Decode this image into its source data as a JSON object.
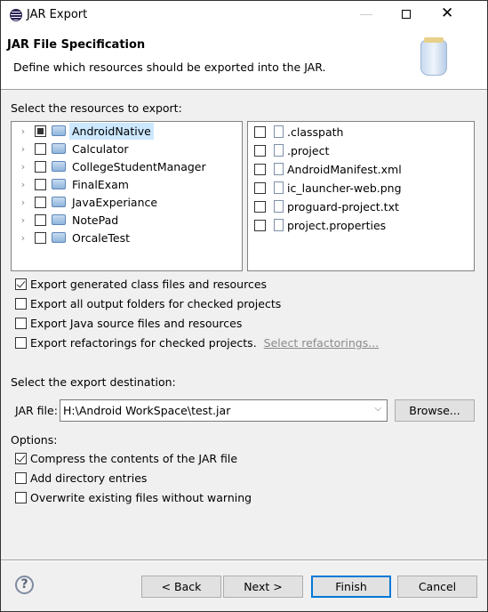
{
  "window": {
    "title": "JAR Export"
  },
  "header": {
    "title": "JAR File Specification",
    "description": "Define which resources should be exported into the JAR."
  },
  "resources": {
    "label": "Select the resources to export:",
    "projects": [
      {
        "name": "AndroidNative",
        "state": "partial",
        "selected": true
      },
      {
        "name": "Calculator",
        "state": "unchecked"
      },
      {
        "name": "CollegeStudentManager",
        "state": "unchecked"
      },
      {
        "name": "FinalExam",
        "state": "unchecked"
      },
      {
        "name": "JavaExperiance",
        "state": "unchecked"
      },
      {
        "name": "NotePad",
        "state": "unchecked"
      },
      {
        "name": "OrcaleTest",
        "state": "unchecked"
      }
    ],
    "files": [
      {
        "name": ".classpath",
        "icon": "xml-file-icon"
      },
      {
        "name": ".project",
        "icon": "xml-file-icon"
      },
      {
        "name": "AndroidManifest.xml",
        "icon": "android-manifest-icon"
      },
      {
        "name": "ic_launcher-web.png",
        "icon": "file-icon"
      },
      {
        "name": "proguard-project.txt",
        "icon": "text-file-icon"
      },
      {
        "name": "project.properties",
        "icon": "text-file-icon"
      }
    ]
  },
  "export_options": [
    {
      "label": "Export generated class files and resources",
      "checked": true
    },
    {
      "label": "Export all output folders for checked projects",
      "checked": false
    },
    {
      "label": "Export Java source files and resources",
      "checked": false
    },
    {
      "label": "Export refactorings for checked projects.",
      "checked": false,
      "link": "Select refactorings..."
    }
  ],
  "destination": {
    "label": "Select the export destination:",
    "jar_label": "JAR file:",
    "jar_value": "H:\\Android WorkSpace\\test.jar",
    "browse": "Browse..."
  },
  "options": {
    "label": "Options:",
    "items": [
      {
        "label": "Compress the contents of the JAR file",
        "checked": true
      },
      {
        "label": "Add directory entries",
        "checked": false
      },
      {
        "label": "Overwrite existing files without warning",
        "checked": false
      }
    ]
  },
  "buttons": {
    "back": "< Back",
    "next": "Next >",
    "finish": "Finish",
    "cancel": "Cancel"
  },
  "colors": {
    "accent": "#0078d7",
    "selection": "#cce8ff"
  }
}
